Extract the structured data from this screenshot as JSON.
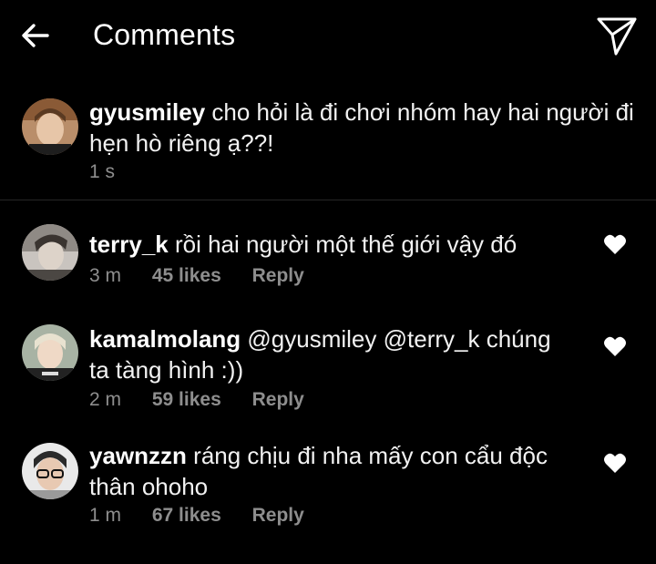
{
  "header": {
    "title": "Comments",
    "back_icon": "arrow-left-icon",
    "send_icon": "paper-plane-icon"
  },
  "caption": {
    "username": "gyusmiley",
    "text_line1": "cho hỏi là đi chơi nhóm hay hai người đi",
    "text_line2": "hẹn hò riêng ạ??!",
    "time": "1 s"
  },
  "comments": [
    {
      "username": "terry_k",
      "text_line1": "rồi hai người một thế giới vậy đó",
      "text_line2": "",
      "time": "3 m",
      "likes": "45 likes",
      "reply": "Reply",
      "like_icon": "heart-icon"
    },
    {
      "username": "kamalmolang",
      "text_line1": "@gyusmiley @terry_k chúng",
      "text_line2": "ta tàng hình :))",
      "time": "2 m",
      "likes": "59 likes",
      "reply": "Reply",
      "like_icon": "heart-icon"
    },
    {
      "username": "yawnzzn",
      "text_line1": "ráng chịu đi nha mấy con cẩu độc",
      "text_line2": "thân ohoho",
      "time": "1 m",
      "likes": "67 likes",
      "reply": "Reply",
      "like_icon": "heart-icon"
    }
  ],
  "colors": {
    "background": "#000000",
    "text": "#ffffff",
    "secondary_text": "#8e8e8e",
    "divider": "#262626"
  }
}
